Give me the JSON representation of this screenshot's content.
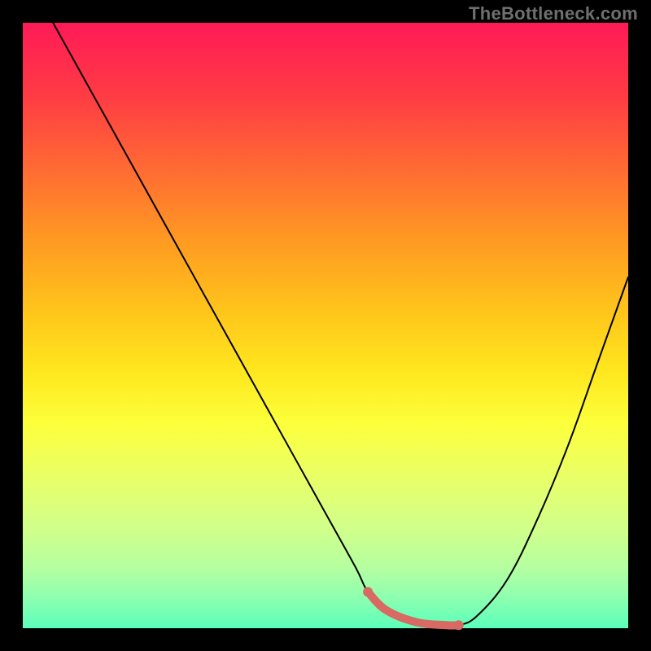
{
  "watermark": "TheBottleneck.com",
  "colors": {
    "background": "#000000",
    "gradient_top": "#ff1a57",
    "gradient_upper": "#ff9a22",
    "gradient_mid": "#ffe81f",
    "gradient_lower": "#cfff8c",
    "gradient_bottom": "#5bffba",
    "curve_stroke": "#000000",
    "highlight_stroke": "#d86a63"
  },
  "chart_data": {
    "type": "line",
    "title": "",
    "xlabel": "",
    "ylabel": "",
    "xlim": [
      0,
      100
    ],
    "ylim": [
      0,
      100
    ],
    "series": [
      {
        "name": "curve",
        "x": [
          5,
          10,
          15,
          20,
          25,
          30,
          35,
          40,
          45,
          50,
          55,
          57,
          60,
          65,
          70,
          72,
          75,
          80,
          85,
          90,
          95,
          100
        ],
        "y": [
          100,
          91,
          82,
          73,
          64,
          55,
          46,
          37,
          28,
          19,
          10,
          6,
          3,
          1,
          0.5,
          0.5,
          2,
          8,
          18,
          30,
          44,
          58
        ]
      }
    ],
    "highlight": {
      "name": "optimal-range",
      "x": [
        57,
        60,
        65,
        70,
        72
      ],
      "y": [
        6,
        3,
        1,
        0.5,
        0.5
      ]
    }
  }
}
